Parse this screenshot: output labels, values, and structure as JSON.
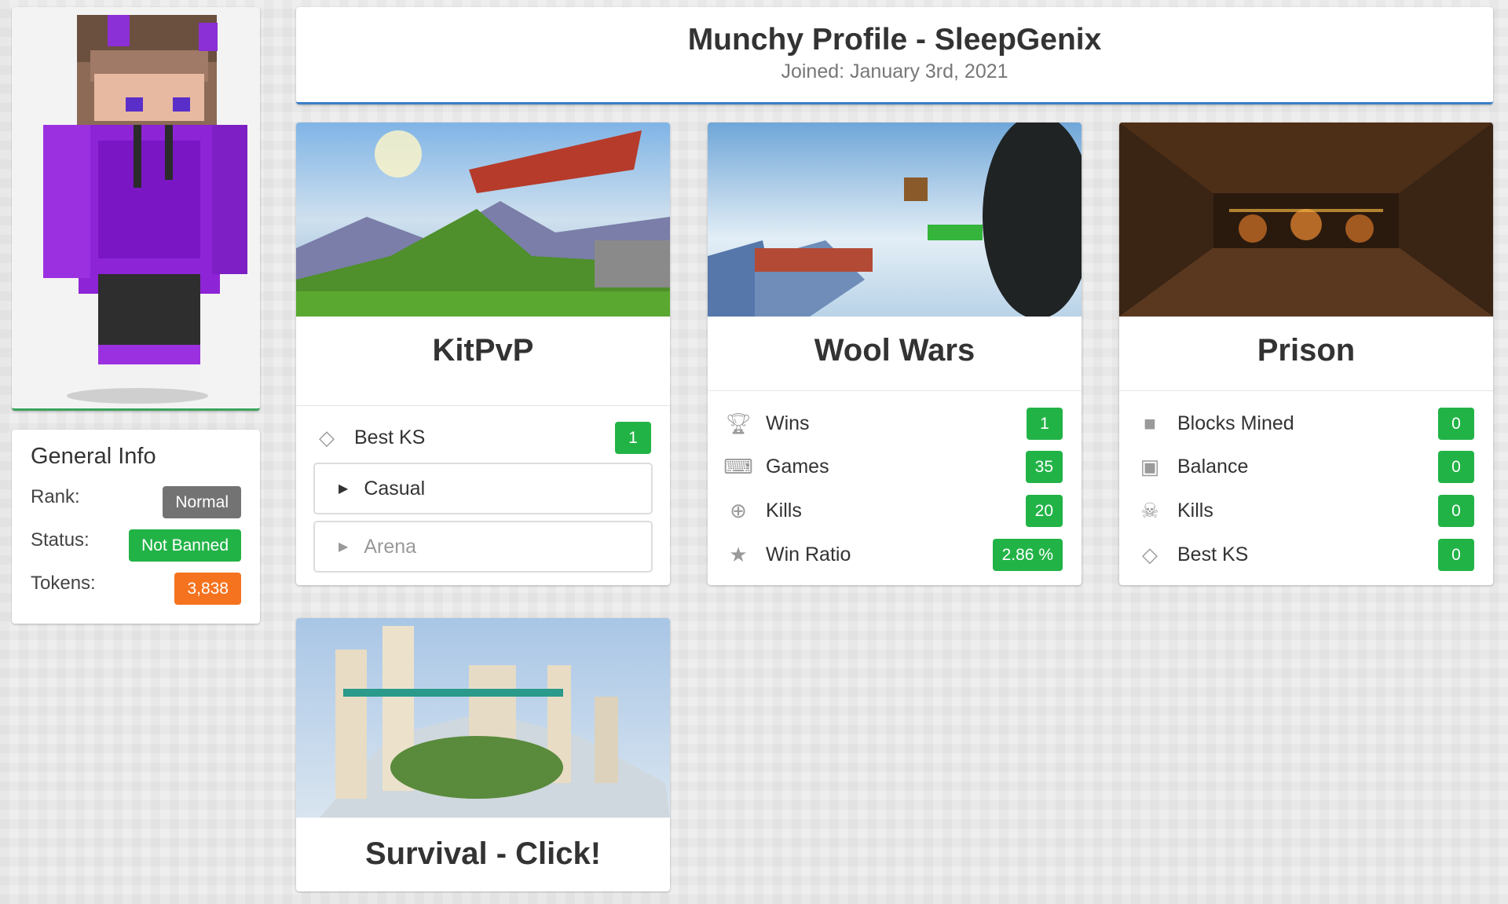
{
  "header": {
    "title": "Munchy Profile - SleepGenix",
    "joined": "Joined: January 3rd, 2021"
  },
  "general_info": {
    "title": "General Info",
    "rows": [
      {
        "label": "Rank:",
        "value": "Normal",
        "color": "#737373"
      },
      {
        "label": "Status:",
        "value": "Not Banned",
        "color": "#22b347"
      },
      {
        "label": "Tokens:",
        "value": "3,838",
        "color": "#f5731f"
      }
    ]
  },
  "kitpvp": {
    "title": "KitPvP",
    "stats": [
      {
        "icon": "diamond-icon",
        "label": "Best KS",
        "value": "1"
      }
    ],
    "sections": [
      {
        "label": "Casual",
        "active": true
      },
      {
        "label": "Arena",
        "active": false
      }
    ]
  },
  "woolwars": {
    "title": "Wool Wars",
    "stats": [
      {
        "icon": "trophy-icon",
        "label": "Wins",
        "value": "1"
      },
      {
        "icon": "gamepad-icon",
        "label": "Games",
        "value": "35"
      },
      {
        "icon": "crosshair-icon",
        "label": "Kills",
        "value": "20"
      },
      {
        "icon": "star-icon",
        "label": "Win Ratio",
        "value": "2.86 %"
      }
    ]
  },
  "prison": {
    "title": "Prison",
    "stats": [
      {
        "icon": "square-icon",
        "label": "Blocks Mined",
        "value": "0"
      },
      {
        "icon": "money-icon",
        "label": "Balance",
        "value": "0"
      },
      {
        "icon": "skull-icon",
        "label": "Kills",
        "value": "0"
      },
      {
        "icon": "diamond-icon",
        "label": "Best KS",
        "value": "0"
      }
    ]
  },
  "survival": {
    "title": "Survival - Click!"
  },
  "colors": {
    "green": "#22b347",
    "orange": "#f5731f",
    "gray_badge": "#737373",
    "header_accent": "#3a7ec9",
    "skin_accent": "#3aa55d"
  }
}
